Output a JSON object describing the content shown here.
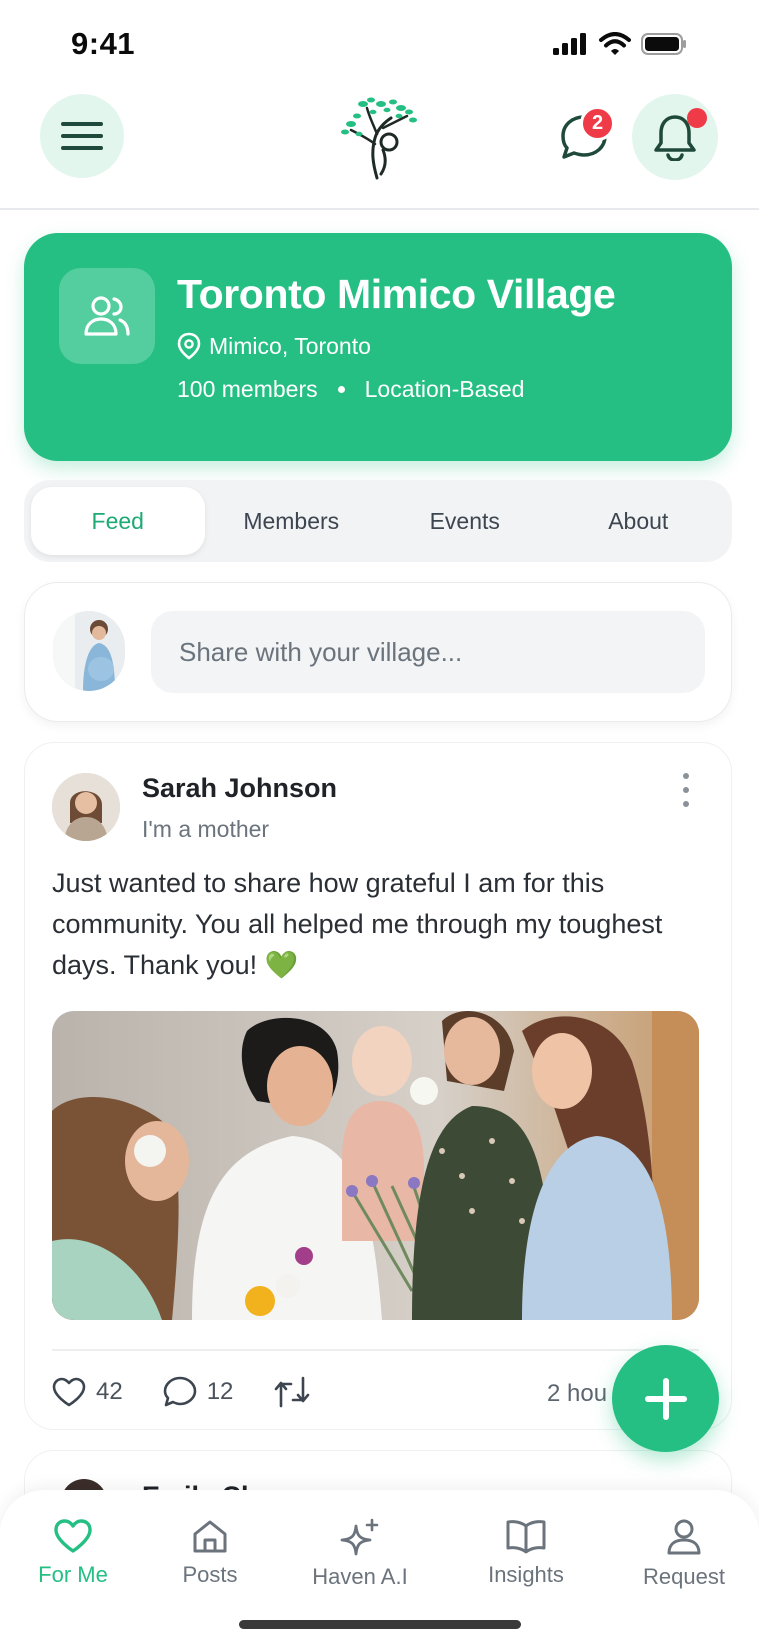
{
  "status_bar": {
    "time": "9:41"
  },
  "header": {
    "chat_badge_count": "2",
    "accent_color": "#25bf84",
    "badge_color": "#ef3b47"
  },
  "group": {
    "name": "Toronto Mimico Village",
    "location": "Mimico, Toronto",
    "members": "100 members",
    "type": "Location-Based"
  },
  "tabs": [
    {
      "label": "Feed",
      "active": true
    },
    {
      "label": "Members",
      "active": false
    },
    {
      "label": "Events",
      "active": false
    },
    {
      "label": "About",
      "active": false
    }
  ],
  "composer": {
    "placeholder": "Share with your village..."
  },
  "post": {
    "author": "Sarah Johnson",
    "role": "I'm a mother",
    "text": "Just wanted to share how grateful I am for this community. You all helped me through my toughest days. Thank you! 💚",
    "likes": "42",
    "comments": "12",
    "time": "2 hou"
  },
  "next_post": {
    "author_partial": "Emily Ch"
  },
  "bottom_nav": [
    {
      "label": "For Me",
      "icon": "heart-icon",
      "active": true
    },
    {
      "label": "Posts",
      "icon": "home-icon",
      "active": false
    },
    {
      "label": "Haven A.I",
      "icon": "sparkle-icon",
      "active": false
    },
    {
      "label": "Insights",
      "icon": "book-icon",
      "active": false
    },
    {
      "label": "Request",
      "icon": "user-icon",
      "active": false
    }
  ]
}
